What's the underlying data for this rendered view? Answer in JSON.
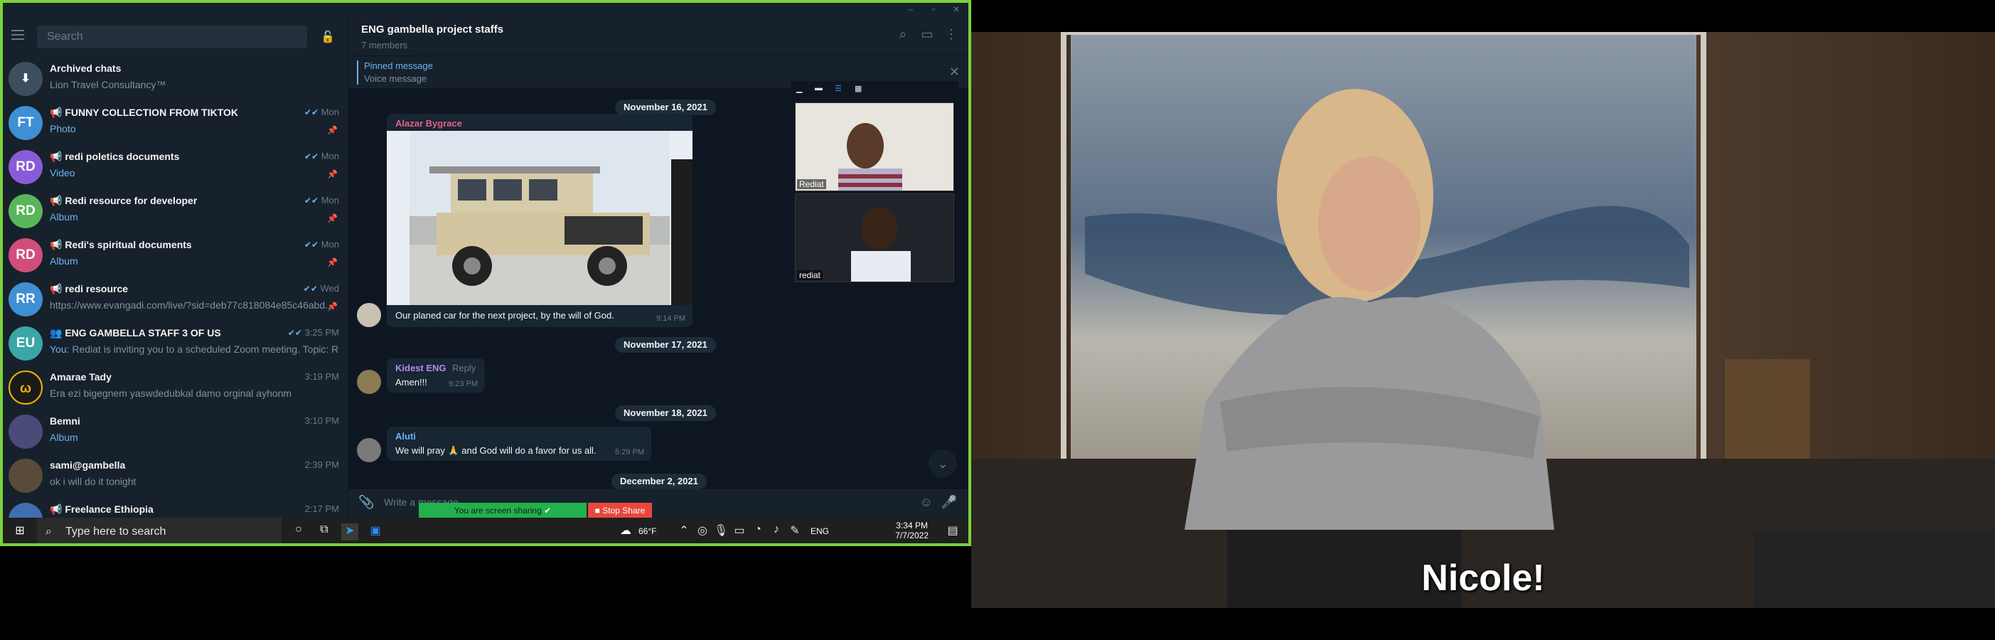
{
  "sidebar": {
    "search_placeholder": "Search",
    "chats": [
      {
        "initials": "",
        "name": "Archived chats",
        "preview": "Lion Travel Consultancy™",
        "time": "",
        "color": "#3d4e60"
      },
      {
        "initials": "FT",
        "name": "FUNNY COLLECTION FROM TIKTOK",
        "preview": "Photo",
        "time": "Mon",
        "color": "#3f8fd4"
      },
      {
        "initials": "RD",
        "name": "redi poletics documents",
        "preview": "Video",
        "time": "Mon",
        "color": "#8a5bd6"
      },
      {
        "initials": "RD",
        "name": "Redi resource for developer",
        "preview": "Album",
        "time": "Mon",
        "color": "#5ab55a"
      },
      {
        "initials": "RD",
        "name": "Redi's spiritual documents",
        "preview": "Album",
        "time": "Mon",
        "color": "#d14e7c"
      },
      {
        "initials": "RR",
        "name": "redi resource",
        "preview": "https://www.evangadi.com/live/?sid=deb77c818084e85c46abd...",
        "time": "Wed",
        "color": "#3f8fd4"
      },
      {
        "initials": "EU",
        "name": "ENG GAMBELLA STAFF 3 OF US",
        "preview_prefix": "You:",
        "preview": "Rediat is inviting you to a scheduled Zoom meeting.  Topic: Re...",
        "time": "3:25 PM",
        "color": "#3ba6a6"
      },
      {
        "initials": "",
        "name": "Amarae Tady",
        "preview": "Era ezi bigegnem yaswdedubkal damo orginal ayhonm",
        "time": "3:19 PM",
        "color": "#1a1a1a"
      },
      {
        "initials": "",
        "name": "Bemni",
        "preview": "Album",
        "time": "3:10 PM",
        "color": "#4b4b7a"
      },
      {
        "initials": "",
        "name": "sami@gambella",
        "preview": "ok i will do it tonight",
        "time": "2:39 PM",
        "color": "#5a4a3a"
      },
      {
        "initials": "",
        "name": "Freelance Ethiopia",
        "preview": "",
        "time": "2:17 PM",
        "color": "#3f6fb0"
      }
    ]
  },
  "chat": {
    "title": "ENG gambella project staffs",
    "members": "7 members",
    "pinned_title": "Pinned message",
    "pinned_text": "Voice message",
    "composer_placeholder": "Write a message...",
    "dates": [
      "November 16, 2021",
      "November 17, 2021",
      "November 18, 2021",
      "December 2, 2021"
    ],
    "messages": [
      {
        "sender": "Alazar Bygrace",
        "text": "Our planed car for the next project, by the will of God.",
        "time": "9:14 PM",
        "color": "#ee5b8a"
      },
      {
        "sender": "Kidest ENG",
        "reply": "Reply",
        "text": "Amen!!!",
        "time": "9:23 PM",
        "color": "#b18ce6"
      },
      {
        "sender": "Aluti",
        "text": "We will pray 🙏 and God will do a favor for us all.",
        "time": "5:29 PM",
        "color": "#6ab3f3"
      }
    ]
  },
  "zoom": {
    "participants": [
      "Rediat",
      "rediat"
    ]
  },
  "share": {
    "status": "You are screen sharing",
    "stop": "Stop Share"
  },
  "taskbar": {
    "search": "Type here to search",
    "weather": "66°F",
    "lang": "ENG",
    "time": "3:34 PM",
    "date": "7/7/2022"
  },
  "video": {
    "subtitle": "Nicole!"
  }
}
